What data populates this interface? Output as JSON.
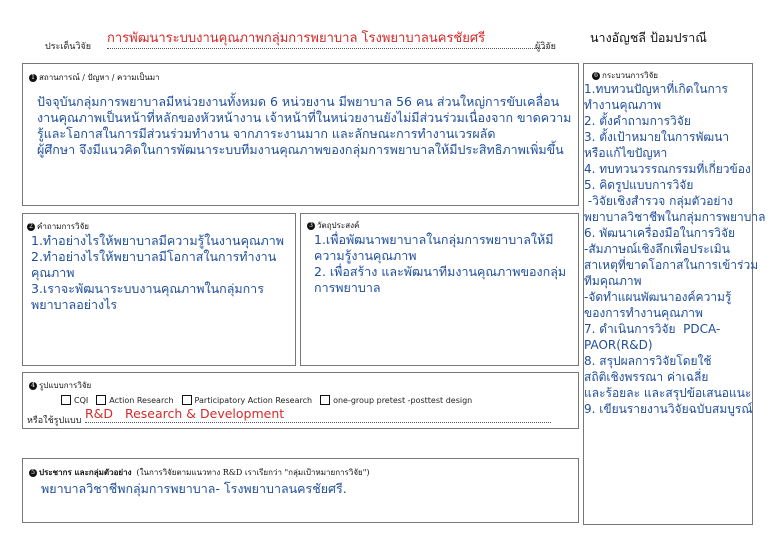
{
  "header": {
    "topic_label": "ประเด็นวิจัย",
    "topic_value": "การพัฒนาระบบงานคุณภาพกลุ่มการพยาบาล โรงพยาบาลนครชัยศรี",
    "researcher_label": "ผู้วิจัย",
    "researcher_value": "นางอัญชลี ป้อมปราณี"
  },
  "section1": {
    "number": "1",
    "title": "สถานการณ์ / ปัญหา / ความเป็นมา",
    "lines": [
      "ปัจจุบันกลุ่มการพยาบาลมีหน่วยงานทั้งหมด 6 หน่วยงาน มีพยาบาล 56 คน ส่วนใหญ่การขับเคลื่อน",
      "งานคุณภาพเป็นหน้าที่หลักของหัวหน้างาน เจ้าหน้าที่ในหน่วยงานยังไม่มีส่วนร่วมเนื่องจาก ขาดความ",
      "รู้และโอกาสในการมีส่วนร่วมทำงาน จากภาระงานมาก และลักษณะการทำงานเวรผลัด",
      "ผู้ศึกษา จึงมีแนวคิดในการพัฒนาระบบทีมงานคุณภาพของกลุ่มการพยาบาลให้มีประสิทธิภาพเพิ่มขึ้น"
    ]
  },
  "section2": {
    "number": "2",
    "title": "คำถามการวิจัย",
    "lines": [
      " 1.ทำอย่างไรให้พยาบาลมีความรู้ในงานคุณภาพ",
      " 2.ทำอย่างไรให้พยาบาลมีโอกาสในการทำงาน",
      "คุณภาพ",
      " 3.เราจะพัฒนาระบบงานคุณภาพในกลุ่มการ",
      "พยาบาลอย่างไร"
    ]
  },
  "section3": {
    "number": "3",
    "title": "วัตถุประสงค์",
    "lines": [
      " 1.เพื่อพัฒนาพยาบาลในกลุ่มการพยาบาลให้มี",
      "ความรู้งานคุณภาพ",
      " 2. เพื่อสร้าง และพัฒนาทีมงานคุณภาพของกลุ่ม",
      "การพยาบาล"
    ]
  },
  "section4": {
    "number": "4",
    "title": "รูปแบบการวิจัย",
    "options": [
      "CQI",
      "Action Research",
      "Participatory Action Research",
      "one-group pretest -posttest design"
    ],
    "other_label": "หรือใช้รูปแบบ",
    "other_value": "R&D   Research & Development"
  },
  "section5": {
    "number": "5",
    "title": "ประชากร และกลุ่มตัวอย่าง",
    "note": "(ในการวิจัยตามแนวทาง R&D เราเรียกว่า \"กลุ่มเป้าหมายการวิจัย\")",
    "value": "พยาบาลวิชาชีพกลุ่มการพยาบาล- โรงพยาบาลนครชัยศรี."
  },
  "section6": {
    "number": "6",
    "title": "กระบวนการวิจัย",
    "lines": [
      "1.ทบทวนปัญหาที่เกิดในการ",
      "ทำงานคุณภาพ",
      "2. ตั้งคำถามการวิจัย",
      "3. ตั้งเป้าหมายในการพัฒนา",
      "หรือแก้ไขปัญหา",
      "4. ทบทวนวรรณกรรมที่เกี่ยวข้อง",
      "5. คิดรูปแบบการวิจัย",
      " -วิจัยเชิงสำรวจ กลุ่มตัวอย่าง",
      "พยาบาลวิชาชีพในกลุ่มการพยาบาล",
      "6. พัฒนาเครื่องมือในการวิจัย",
      "-สัมภาษณ์เชิงลึกเพื่อประเมิน",
      "สาเหตุที่ขาดโอกาสในการเข้าร่วม",
      "ทีมคุณภาพ",
      "-จัดทำแผนพัฒนาองค์ความรู้",
      "ของการทำงานคุณภาพ",
      "7. ดำเนินการวิจัย  PDCA-",
      "PAOR(R&D)",
      "8. สรุปผลการวิจัยโดยใช้",
      "สถิติเชิงพรรณา ค่าเฉลี่ย",
      "และร้อยละ และสรุปข้อเสนอแนะ",
      "9. เขียนรายงานวิจัยฉบับสมบูรณ์"
    ]
  }
}
